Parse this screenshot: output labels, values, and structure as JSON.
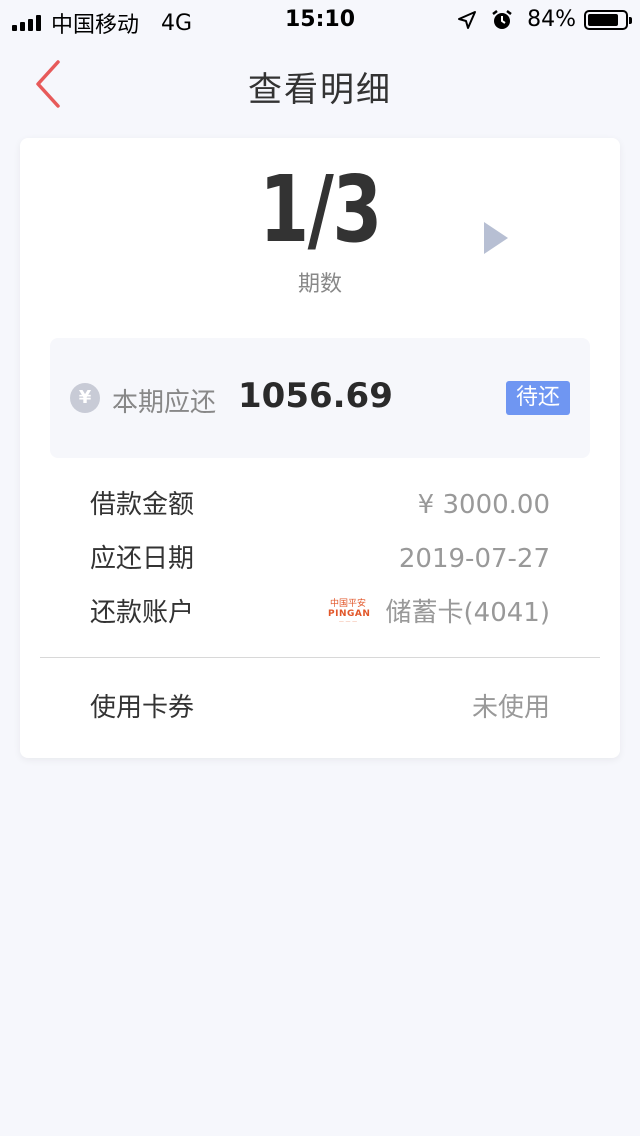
{
  "status_bar": {
    "carrier": "中国移动",
    "network": "4G",
    "time": "15:10",
    "battery": "84%",
    "battery_level": 0.84
  },
  "nav": {
    "title": "查看明细",
    "back_icon": "chevron-left-icon",
    "accent_color": "#e75a5a"
  },
  "period": {
    "current": "1",
    "total": "3",
    "display": "1/3",
    "label": "期数"
  },
  "due": {
    "currency_icon": "¥",
    "label": "本期应还",
    "amount": "1056.69",
    "status": "待还",
    "status_color": "#6f96f2"
  },
  "details": [
    {
      "label": "借款金额",
      "value": "¥ 3000.00"
    },
    {
      "label": "应还日期",
      "value": "2019-07-27"
    },
    {
      "label": "还款账户",
      "value": "储蓄卡(4041)",
      "bank_logo": {
        "line1": "中国平安",
        "line2": "PINGAN"
      }
    }
  ],
  "coupon": {
    "label": "使用卡券",
    "value": "未使用"
  }
}
